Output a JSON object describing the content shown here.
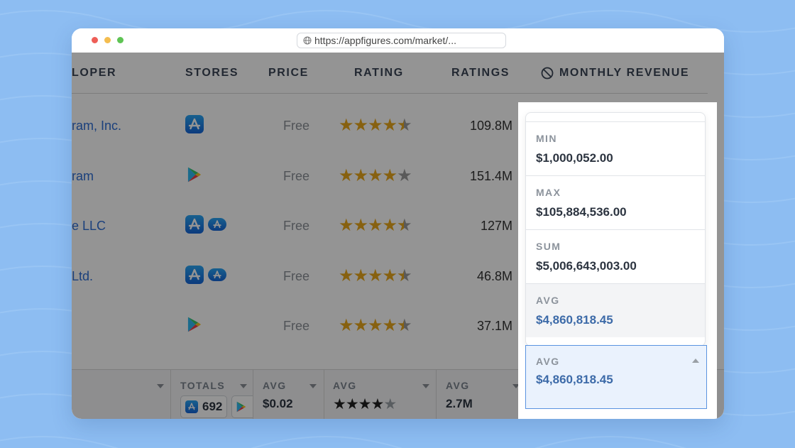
{
  "browser": {
    "url": "https://appfigures.com/market/..."
  },
  "table": {
    "headers": {
      "developer": "LOPER",
      "stores": "STORES",
      "price": "PRICE",
      "rating": "RATING",
      "ratings": "RATINGS",
      "revenue": "MONTHLY REVENUE"
    },
    "rows": [
      {
        "developer": "ram, Inc.",
        "stores": [
          "app-store"
        ],
        "price": "Free",
        "rating": 4.5,
        "ratings": "109.8M"
      },
      {
        "developer": "ram",
        "stores": [
          "google-play"
        ],
        "price": "Free",
        "rating": 4.0,
        "ratings": "151.4M"
      },
      {
        "developer": "e LLC",
        "stores": [
          "app-store",
          "app-store-ipad"
        ],
        "price": "Free",
        "rating": 4.5,
        "ratings": "127M"
      },
      {
        "developer": " Ltd.",
        "stores": [
          "app-store",
          "app-store-ipad"
        ],
        "price": "Free",
        "rating": 4.5,
        "ratings": "46.8M"
      },
      {
        "developer": "",
        "stores": [
          "google-play"
        ],
        "price": "Free",
        "rating": 4.5,
        "ratings": "37.1M"
      }
    ]
  },
  "footer": {
    "stores_label": "TOTALS",
    "stores_total": "692",
    "price_label": "AVG",
    "price_value": "$0.02",
    "rating_label": "AVG",
    "rating_value": 4,
    "ratings_label": "AVG",
    "ratings_value": "2.7M",
    "revenue_label": "AVG",
    "revenue_value": "$4,860,818.45"
  },
  "revenue_dropdown": {
    "options": [
      {
        "label": "MIN",
        "value": "$1,000,052.00"
      },
      {
        "label": "MAX",
        "value": "$105,884,536.00"
      },
      {
        "label": "SUM",
        "value": "$5,006,643,003.00"
      },
      {
        "label": "AVG",
        "value": "$4,860,818.45"
      }
    ],
    "selected": "AVG"
  },
  "colors": {
    "background": "#8dbdf2",
    "link": "#2f6fd6",
    "star": "#e8a81c",
    "accent": "#3c6aa8",
    "select_bg": "#eaf2fd",
    "select_border": "#5a93e0"
  }
}
